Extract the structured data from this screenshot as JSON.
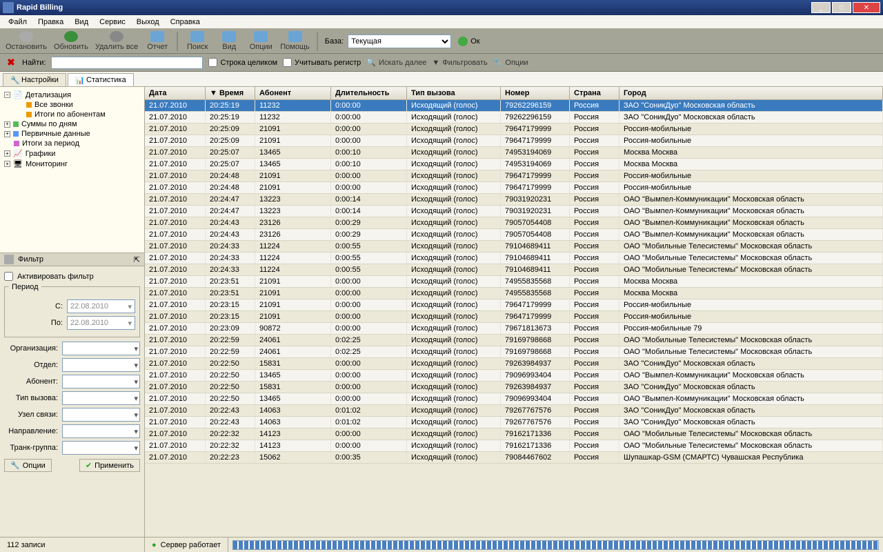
{
  "window": {
    "title": "Rapid Billing"
  },
  "menu": [
    "Файл",
    "Правка",
    "Вид",
    "Сервис",
    "Выход",
    "Справка"
  ],
  "toolbar1": {
    "stop": "Остановить",
    "refresh": "Обновить",
    "delall": "Удалить все",
    "report": "Отчет",
    "search": "Поиск",
    "view": "Вид",
    "options": "Опции",
    "help": "Помощь",
    "base_label": "База:",
    "base_value": "Текущая",
    "ok": "Ок"
  },
  "findbar": {
    "find_label": "Найти:",
    "whole": "Строка целиком",
    "case": "Учитывать регистр",
    "next": "Искать далее",
    "filter": "Фильтровать",
    "opts": "Опции"
  },
  "tabs": {
    "settings": "Настройки",
    "stats": "Статистика"
  },
  "tree": {
    "detail": "Детализация",
    "allcalls": "Все звонки",
    "bysub": "Итоги по абонентам",
    "byday": "Суммы по дням",
    "raw": "Первичные данные",
    "period": "Итоги за период",
    "charts": "Графики",
    "monitor": "Мониторинг"
  },
  "filter": {
    "title": "Фильтр",
    "activate": "Активировать фильтр",
    "period_legend": "Период",
    "from": "С:",
    "to": "По:",
    "from_val": "22.08.2010",
    "to_val": "22.08.2010",
    "org": "Организация:",
    "dept": "Отдел:",
    "sub": "Абонент:",
    "calltype": "Тип вызова:",
    "node": "Узел связи:",
    "dir": "Направление:",
    "trunk": "Транк-группа:",
    "opts": "Опции",
    "apply": "Применить"
  },
  "columns": [
    "Дата",
    "Время",
    "Абонент",
    "Длительность",
    "Тип вызова",
    "Номер",
    "Страна",
    "Город"
  ],
  "rows": [
    [
      "21.07.2010",
      "20:25:19",
      "11232",
      "0:00:00",
      "Исходящий (голос)",
      "79262296159",
      "Россия",
      "ЗАО \"СоникДуо\"   Московская область"
    ],
    [
      "21.07.2010",
      "20:25:19",
      "11232",
      "0:00:00",
      "Исходящий (голос)",
      "79262296159",
      "Россия",
      "ЗАО \"СоникДуо\"   Московская область"
    ],
    [
      "21.07.2010",
      "20:25:09",
      "21091",
      "0:00:00",
      "Исходящий (голос)",
      "79647179999",
      "Россия",
      "Россия-мобильные"
    ],
    [
      "21.07.2010",
      "20:25:09",
      "21091",
      "0:00:00",
      "Исходящий (голос)",
      "79647179999",
      "Россия",
      "Россия-мобильные"
    ],
    [
      "21.07.2010",
      "20:25:07",
      "13465",
      "0:00:10",
      "Исходящий (голос)",
      "74953194069",
      "Россия",
      "Москва   Москва"
    ],
    [
      "21.07.2010",
      "20:25:07",
      "13465",
      "0:00:10",
      "Исходящий (голос)",
      "74953194069",
      "Россия",
      "Москва   Москва"
    ],
    [
      "21.07.2010",
      "20:24:48",
      "21091",
      "0:00:00",
      "Исходящий (голос)",
      "79647179999",
      "Россия",
      "Россия-мобильные"
    ],
    [
      "21.07.2010",
      "20:24:48",
      "21091",
      "0:00:00",
      "Исходящий (голос)",
      "79647179999",
      "Россия",
      "Россия-мобильные"
    ],
    [
      "21.07.2010",
      "20:24:47",
      "13223",
      "0:00:14",
      "Исходящий (голос)",
      "79031920231",
      "Россия",
      "ОАО \"Вымпел-Коммуникации\"   Московская область"
    ],
    [
      "21.07.2010",
      "20:24:47",
      "13223",
      "0:00:14",
      "Исходящий (голос)",
      "79031920231",
      "Россия",
      "ОАО \"Вымпел-Коммуникации\"   Московская область"
    ],
    [
      "21.07.2010",
      "20:24:43",
      "23126",
      "0:00:29",
      "Исходящий (голос)",
      "79057054408",
      "Россия",
      "ОАО \"Вымпел-Коммуникации\"   Московская область"
    ],
    [
      "21.07.2010",
      "20:24:43",
      "23126",
      "0:00:29",
      "Исходящий (голос)",
      "79057054408",
      "Россия",
      "ОАО \"Вымпел-Коммуникации\"   Московская область"
    ],
    [
      "21.07.2010",
      "20:24:33",
      "11224",
      "0:00:55",
      "Исходящий (голос)",
      "79104689411",
      "Россия",
      "ОАО \"Мобильные Телесистемы\"   Московская область"
    ],
    [
      "21.07.2010",
      "20:24:33",
      "11224",
      "0:00:55",
      "Исходящий (голос)",
      "79104689411",
      "Россия",
      "ОАО \"Мобильные Телесистемы\"   Московская область"
    ],
    [
      "21.07.2010",
      "20:24:33",
      "11224",
      "0:00:55",
      "Исходящий (голос)",
      "79104689411",
      "Россия",
      "ОАО \"Мобильные Телесистемы\"   Московская область"
    ],
    [
      "21.07.2010",
      "20:23:51",
      "21091",
      "0:00:00",
      "Исходящий (голос)",
      "74955835568",
      "Россия",
      "Москва   Москва"
    ],
    [
      "21.07.2010",
      "20:23:51",
      "21091",
      "0:00:00",
      "Исходящий (голос)",
      "74955835568",
      "Россия",
      "Москва   Москва"
    ],
    [
      "21.07.2010",
      "20:23:15",
      "21091",
      "0:00:00",
      "Исходящий (голос)",
      "79647179999",
      "Россия",
      "Россия-мобильные"
    ],
    [
      "21.07.2010",
      "20:23:15",
      "21091",
      "0:00:00",
      "Исходящий (голос)",
      "79647179999",
      "Россия",
      "Россия-мобильные"
    ],
    [
      "21.07.2010",
      "20:23:09",
      "90872",
      "0:00:00",
      "Исходящий (голос)",
      "79671813673",
      "Россия",
      "Россия-мобильные 79"
    ],
    [
      "21.07.2010",
      "20:22:59",
      "24061",
      "0:02:25",
      "Исходящий (голос)",
      "79169798668",
      "Россия",
      "ОАО \"Мобильные Телесистемы\"   Московская область"
    ],
    [
      "21.07.2010",
      "20:22:59",
      "24061",
      "0:02:25",
      "Исходящий (голос)",
      "79169798668",
      "Россия",
      "ОАО \"Мобильные Телесистемы\"   Московская область"
    ],
    [
      "21.07.2010",
      "20:22:50",
      "15831",
      "0:00:00",
      "Исходящий (голос)",
      "79263984937",
      "Россия",
      "ЗАО \"СоникДуо\"   Московская область"
    ],
    [
      "21.07.2010",
      "20:22:50",
      "13465",
      "0:00:00",
      "Исходящий (голос)",
      "79096993404",
      "Россия",
      "ОАО \"Вымпел-Коммуникации\"   Московская область"
    ],
    [
      "21.07.2010",
      "20:22:50",
      "15831",
      "0:00:00",
      "Исходящий (голос)",
      "79263984937",
      "Россия",
      "ЗАО \"СоникДуо\"   Московская область"
    ],
    [
      "21.07.2010",
      "20:22:50",
      "13465",
      "0:00:00",
      "Исходящий (голос)",
      "79096993404",
      "Россия",
      "ОАО \"Вымпел-Коммуникации\"   Московская область"
    ],
    [
      "21.07.2010",
      "20:22:43",
      "14063",
      "0:01:02",
      "Исходящий (голос)",
      "79267767576",
      "Россия",
      "ЗАО \"СоникДуо\"   Московская область"
    ],
    [
      "21.07.2010",
      "20:22:43",
      "14063",
      "0:01:02",
      "Исходящий (голос)",
      "79267767576",
      "Россия",
      "ЗАО \"СоникДуо\"   Московская область"
    ],
    [
      "21.07.2010",
      "20:22:32",
      "14123",
      "0:00:00",
      "Исходящий (голос)",
      "79162171336",
      "Россия",
      "ОАО \"Мобильные Телесистемы\"   Московская область"
    ],
    [
      "21.07.2010",
      "20:22:32",
      "14123",
      "0:00:00",
      "Исходящий (голос)",
      "79162171336",
      "Россия",
      "ОАО \"Мобильные Телесистемы\"   Московская область"
    ],
    [
      "21.07.2010",
      "20:22:23",
      "15062",
      "0:00:35",
      "Исходящий (голос)",
      "79084467602",
      "Россия",
      "Шупашкар-GSM (СМАРТС)   Чувашская Республика"
    ]
  ],
  "status": {
    "count": "112 записи",
    "server": "Сервер работает"
  }
}
